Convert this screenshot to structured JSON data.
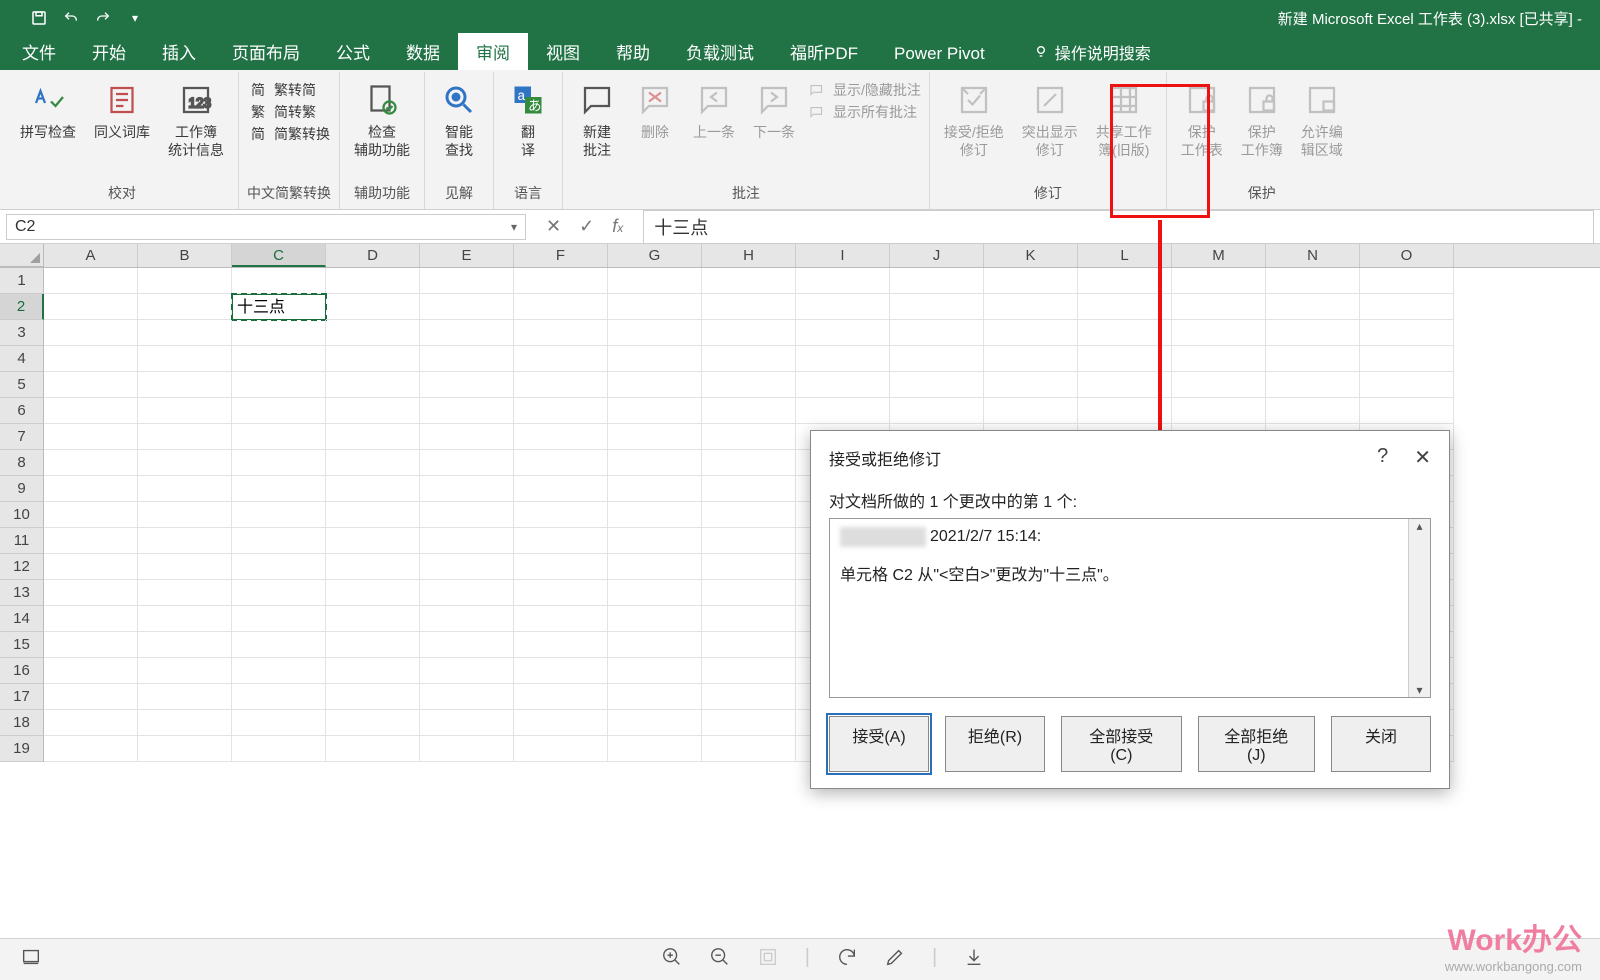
{
  "title": "新建 Microsoft Excel 工作表 (3).xlsx  [已共享] -",
  "tabs": [
    "文件",
    "开始",
    "插入",
    "页面布局",
    "公式",
    "数据",
    "审阅",
    "视图",
    "帮助",
    "负载测试",
    "福昕PDF",
    "Power Pivot"
  ],
  "active_tab_index": 6,
  "tell_me": "操作说明搜索",
  "ribbon": {
    "groups": {
      "proofing": {
        "label": "校对",
        "spell": "拼写检查",
        "thesaurus": "同义词库",
        "stats": "工作簿\n统计信息"
      },
      "chinese": {
        "label": "中文简繁转换",
        "a": "繁转简",
        "b": "简转繁",
        "c": "简繁转换"
      },
      "access": {
        "label": "辅助功能",
        "btn": "检查\n辅助功能"
      },
      "insights": {
        "label": "见解",
        "btn": "智能\n查找"
      },
      "lang": {
        "label": "语言",
        "btn": "翻\n译"
      },
      "comments": {
        "label": "批注",
        "new": "新建\n批注",
        "del": "删除",
        "prev": "上一条",
        "next": "下一条",
        "show1": "显示/隐藏批注",
        "show2": "显示所有批注"
      },
      "changes": {
        "label": "修订",
        "accrej": "接受/拒绝\n修订",
        "highlight": "突出显示\n修订",
        "share": "共享工作\n簿(旧版)"
      },
      "protect": {
        "label": "保护",
        "sheet": "保护\n工作表",
        "book": "保护\n工作簿",
        "range": "允许编\n辑区域"
      }
    }
  },
  "namebox": "C2",
  "formula": "十三点",
  "columns": [
    "A",
    "B",
    "C",
    "D",
    "E",
    "F",
    "G",
    "H",
    "I",
    "J",
    "K",
    "L",
    "M",
    "N",
    "O"
  ],
  "selected_col_index": 2,
  "row_count": 19,
  "selected_row_index": 1,
  "cell_value": "十三点",
  "dialog": {
    "title": "接受或拒绝修订",
    "subtitle": "对文档所做的 1 个更改中的第 1 个:",
    "timestamp": "2021/2/7 15:14:",
    "change_text": "单元格 C2 从\"<空白>\"更改为\"十三点\"。",
    "buttons": {
      "accept": "接受(A)",
      "reject": "拒绝(R)",
      "accept_all": "全部接受(C)",
      "reject_all": "全部拒绝(J)",
      "close": "关闭"
    }
  },
  "watermark": {
    "big": "Work办公",
    "small": "www.workbangong.com"
  }
}
